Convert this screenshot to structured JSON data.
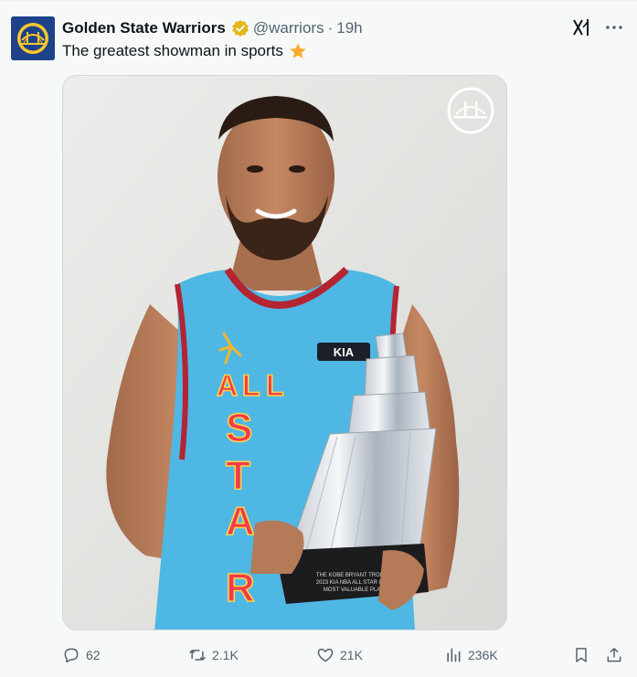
{
  "tweet": {
    "author_name": "Golden State Warriors",
    "handle": "@warriors",
    "separator": "·",
    "time": "19h",
    "text": "The greatest showman in sports",
    "emoji_icon": "star-icon"
  },
  "media": {
    "jersey_letters": [
      "A",
      "L",
      "L",
      "S",
      "T",
      "A",
      "R"
    ],
    "sponsor": "KIA",
    "trophy_plaque": [
      "THE KOBE BRYANT TROPHY",
      "2023 KIA NBA ALL STAR GAME",
      "MOST VALUABLE PLAYER"
    ]
  },
  "actions": {
    "replies": "62",
    "retweets": "2.1K",
    "likes": "21K",
    "views": "236K"
  },
  "colors": {
    "brand_blue": "#1d428a",
    "brand_gold": "#ffc72c",
    "verified_gold": "#e2b719",
    "text_secondary": "#536471",
    "jersey": "#4fb7e3"
  }
}
